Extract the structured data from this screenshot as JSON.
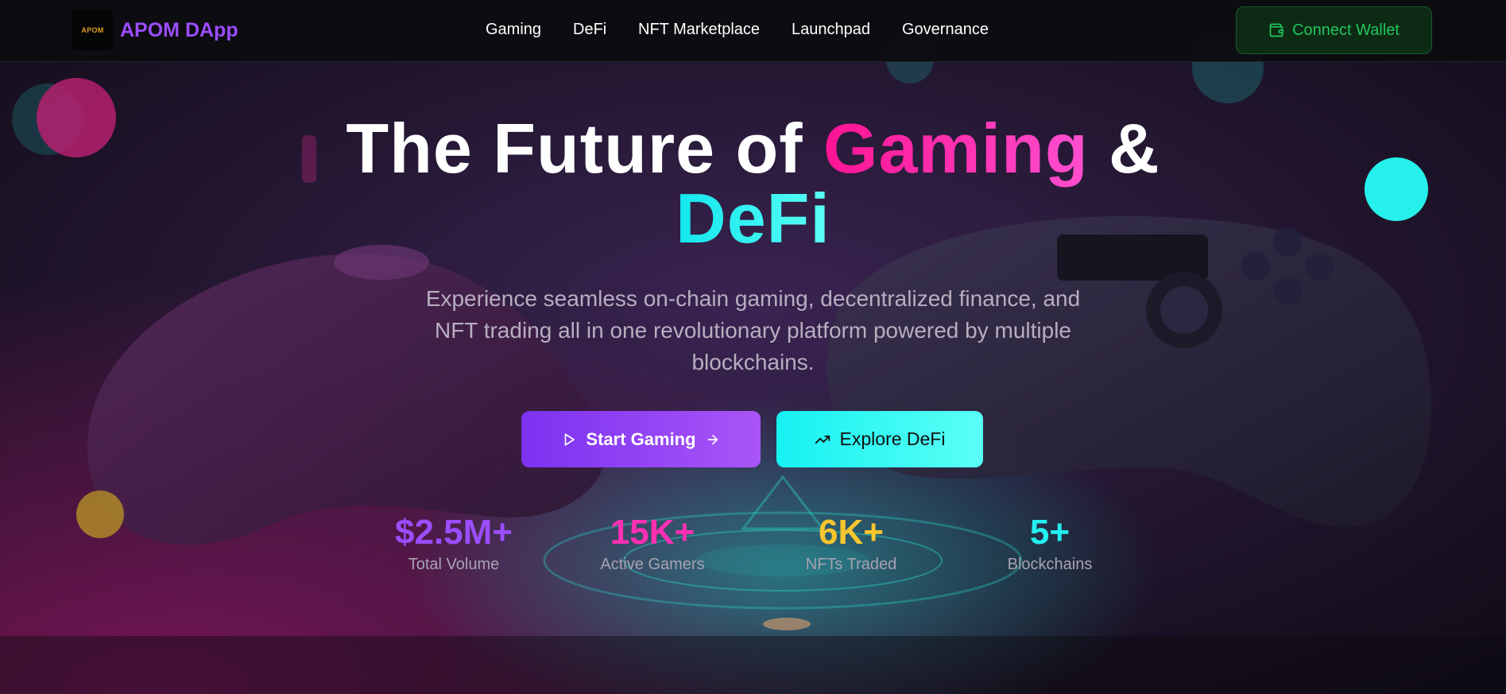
{
  "header": {
    "logo_text": "APOM",
    "brand": "APOM DApp",
    "nav": [
      {
        "label": "Gaming"
      },
      {
        "label": "DeFi"
      },
      {
        "label": "NFT Marketplace"
      },
      {
        "label": "Launchpad"
      },
      {
        "label": "Governance"
      }
    ],
    "connect_label": "Connect Wallet"
  },
  "hero": {
    "title_part1": "The Future of ",
    "title_highlight1": "Gaming",
    "title_part2": " &",
    "title_highlight2": "DeFi",
    "subtitle": "Experience seamless on-chain gaming, decentralized finance, and NFT trading all in one revolutionary platform powered by multiple blockchains.",
    "primary_button": "Start Gaming",
    "secondary_button": "Explore DeFi"
  },
  "stats": [
    {
      "value": "$2.5M+",
      "label": "Total Volume",
      "color": "#9b4dff"
    },
    {
      "value": "15K+",
      "label": "Active Gamers",
      "color": "#ff2fb4"
    },
    {
      "value": "6K+",
      "label": "NFTs Traded",
      "color": "#f7c52e"
    },
    {
      "value": "5+",
      "label": "Blockchains",
      "color": "#22f0f0"
    }
  ],
  "colors": {
    "accent_purple": "#9b4dff",
    "accent_pink": "#ff1fb0",
    "accent_cyan": "#22f2f2",
    "wallet_green": "#22c55e"
  },
  "icons": {
    "wallet": "wallet-icon",
    "play": "play-icon",
    "arrow": "arrow-right-icon",
    "trend": "trending-up-icon"
  }
}
